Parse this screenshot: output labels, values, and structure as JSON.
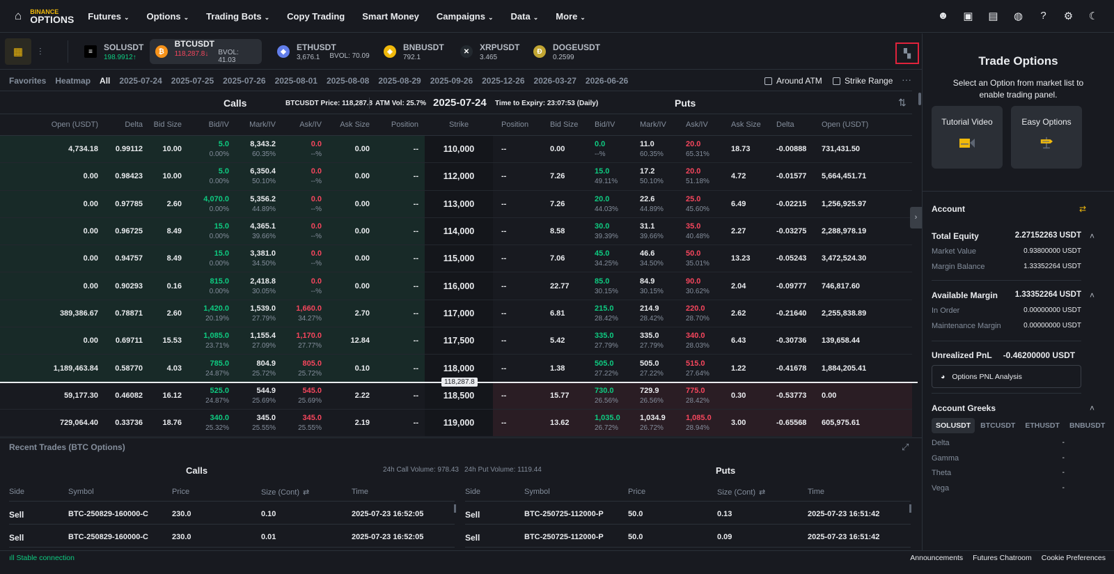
{
  "nav": {
    "logo_top": "BINANCE",
    "logo_bottom": "OPTIONS",
    "items": [
      {
        "label": "Futures",
        "dropdown": true
      },
      {
        "label": "Options",
        "dropdown": true
      },
      {
        "label": "Trading Bots",
        "dropdown": true
      },
      {
        "label": "Copy Trading",
        "dropdown": false
      },
      {
        "label": "Smart Money",
        "dropdown": false
      },
      {
        "label": "Campaigns",
        "dropdown": true
      },
      {
        "label": "Data",
        "dropdown": true
      },
      {
        "label": "More",
        "dropdown": true
      }
    ],
    "icons": [
      "user-icon",
      "wallet-icon",
      "orders-icon",
      "globe-icon",
      "help-icon",
      "gear-icon",
      "moon-icon"
    ]
  },
  "symbols": [
    {
      "name": "SOLUSDT",
      "price": "198.9912",
      "dir": "↑",
      "color": "#0ecb81",
      "bvol": "",
      "icon_bg": "#000000",
      "icon": "≡"
    },
    {
      "name": "BTCUSDT",
      "price": "118,287.8",
      "dir": "↓",
      "color": "#f6465d",
      "bvol": "BVOL: 41.03",
      "icon_bg": "#f7931a",
      "icon": "₿"
    },
    {
      "name": "ETHUSDT",
      "price": "3,676.1",
      "dir": "",
      "color": "#b7bdc6",
      "bvol": "BVOL: 70.09",
      "icon_bg": "#627eea",
      "icon": "◆"
    },
    {
      "name": "BNBUSDT",
      "price": "792.1",
      "dir": "",
      "color": "#b7bdc6",
      "bvol": "",
      "icon_bg": "#f0b90b",
      "icon": "◈"
    },
    {
      "name": "XRPUSDT",
      "price": "3.465",
      "dir": "",
      "color": "#b7bdc6",
      "bvol": "",
      "icon_bg": "#23292f",
      "icon": "✕"
    },
    {
      "name": "DOGEUSDT",
      "price": "0.2599",
      "dir": "",
      "color": "#b7bdc6",
      "bvol": "",
      "icon_bg": "#c2a633",
      "icon": "Ð"
    }
  ],
  "dates": {
    "tabs": [
      "Favorites",
      "Heatmap",
      "All",
      "2025-07-24",
      "2025-07-25",
      "2025-07-26",
      "2025-08-01",
      "2025-08-08",
      "2025-08-29",
      "2025-09-26",
      "2025-12-26",
      "2026-03-27",
      "2026-06-26"
    ],
    "active": "All",
    "around_atm": "Around ATM",
    "strike_range": "Strike Range"
  },
  "chain": {
    "calls_title": "Calls",
    "puts_title": "Puts",
    "price_label": "BTCUSDT Price: 118,287.8",
    "atm_vol": "ATM Vol: 25.7%",
    "expiry": "2025-07-24",
    "time_to_expiry": "Time to Expiry: 23:07:53 (Daily)",
    "index_price": "118,287.8",
    "call_columns": [
      "Open (USDT)",
      "Delta",
      "Bid Size",
      "Bid/IV",
      "Mark/IV",
      "Ask/IV",
      "Ask Size",
      "Position"
    ],
    "strike_column": "Strike",
    "put_columns": [
      "Position",
      "Bid Size",
      "Bid/IV",
      "Mark/IV",
      "Ask/IV",
      "Ask Size",
      "Delta",
      "Open (USDT)"
    ],
    "rows": [
      {
        "strike": "110,000",
        "call_itm": true,
        "put_itm": false,
        "call": {
          "open": "4,734.18",
          "delta": "0.99112",
          "bid_size": "10.00",
          "bid": "5.0",
          "bid_iv": "0.00%",
          "mark": "8,343.2",
          "mark_iv": "60.35%",
          "ask": "0.0",
          "ask_iv": "--%",
          "ask_size": "0.00",
          "position": "--"
        },
        "put": {
          "position": "--",
          "bid_size": "0.00",
          "bid": "0.0",
          "bid_iv": "--%",
          "mark": "11.0",
          "mark_iv": "60.35%",
          "ask": "20.0",
          "ask_iv": "65.31%",
          "ask_size": "18.73",
          "delta": "-0.00888",
          "open": "731,431.50"
        }
      },
      {
        "strike": "112,000",
        "call_itm": true,
        "put_itm": false,
        "call": {
          "open": "0.00",
          "delta": "0.98423",
          "bid_size": "10.00",
          "bid": "5.0",
          "bid_iv": "0.00%",
          "mark": "6,350.4",
          "mark_iv": "50.10%",
          "ask": "0.0",
          "ask_iv": "--%",
          "ask_size": "0.00",
          "position": "--"
        },
        "put": {
          "position": "--",
          "bid_size": "7.26",
          "bid": "15.0",
          "bid_iv": "49.11%",
          "mark": "17.2",
          "mark_iv": "50.10%",
          "ask": "20.0",
          "ask_iv": "51.18%",
          "ask_size": "4.72",
          "delta": "-0.01577",
          "open": "5,664,451.71"
        }
      },
      {
        "strike": "113,000",
        "call_itm": true,
        "put_itm": false,
        "call": {
          "open": "0.00",
          "delta": "0.97785",
          "bid_size": "2.60",
          "bid": "4,070.0",
          "bid_iv": "0.00%",
          "mark": "5,356.2",
          "mark_iv": "44.89%",
          "ask": "0.0",
          "ask_iv": "--%",
          "ask_size": "0.00",
          "position": "--"
        },
        "put": {
          "position": "--",
          "bid_size": "7.26",
          "bid": "20.0",
          "bid_iv": "44.03%",
          "mark": "22.6",
          "mark_iv": "44.89%",
          "ask": "25.0",
          "ask_iv": "45.60%",
          "ask_size": "6.49",
          "delta": "-0.02215",
          "open": "1,256,925.97"
        }
      },
      {
        "strike": "114,000",
        "call_itm": true,
        "put_itm": false,
        "call": {
          "open": "0.00",
          "delta": "0.96725",
          "bid_size": "8.49",
          "bid": "15.0",
          "bid_iv": "0.00%",
          "mark": "4,365.1",
          "mark_iv": "39.66%",
          "ask": "0.0",
          "ask_iv": "--%",
          "ask_size": "0.00",
          "position": "--"
        },
        "put": {
          "position": "--",
          "bid_size": "8.58",
          "bid": "30.0",
          "bid_iv": "39.39%",
          "mark": "31.1",
          "mark_iv": "39.66%",
          "ask": "35.0",
          "ask_iv": "40.48%",
          "ask_size": "2.27",
          "delta": "-0.03275",
          "open": "2,288,978.19"
        }
      },
      {
        "strike": "115,000",
        "call_itm": true,
        "put_itm": false,
        "call": {
          "open": "0.00",
          "delta": "0.94757",
          "bid_size": "8.49",
          "bid": "15.0",
          "bid_iv": "0.00%",
          "mark": "3,381.0",
          "mark_iv": "34.50%",
          "ask": "0.0",
          "ask_iv": "--%",
          "ask_size": "0.00",
          "position": "--"
        },
        "put": {
          "position": "--",
          "bid_size": "7.06",
          "bid": "45.0",
          "bid_iv": "34.25%",
          "mark": "46.6",
          "mark_iv": "34.50%",
          "ask": "50.0",
          "ask_iv": "35.01%",
          "ask_size": "13.23",
          "delta": "-0.05243",
          "open": "3,472,524.30"
        }
      },
      {
        "strike": "116,000",
        "call_itm": true,
        "put_itm": false,
        "call": {
          "open": "0.00",
          "delta": "0.90293",
          "bid_size": "0.16",
          "bid": "815.0",
          "bid_iv": "0.00%",
          "mark": "2,418.8",
          "mark_iv": "30.05%",
          "ask": "0.0",
          "ask_iv": "--%",
          "ask_size": "0.00",
          "position": "--"
        },
        "put": {
          "position": "--",
          "bid_size": "22.77",
          "bid": "85.0",
          "bid_iv": "30.15%",
          "mark": "84.9",
          "mark_iv": "30.15%",
          "ask": "90.0",
          "ask_iv": "30.62%",
          "ask_size": "2.04",
          "delta": "-0.09777",
          "open": "746,817.60"
        }
      },
      {
        "strike": "117,000",
        "call_itm": true,
        "put_itm": false,
        "call": {
          "open": "389,386.67",
          "delta": "0.78871",
          "bid_size": "2.60",
          "bid": "1,420.0",
          "bid_iv": "20.19%",
          "mark": "1,539.0",
          "mark_iv": "27.79%",
          "ask": "1,660.0",
          "ask_iv": "34.27%",
          "ask_size": "2.70",
          "position": "--"
        },
        "put": {
          "position": "--",
          "bid_size": "6.81",
          "bid": "215.0",
          "bid_iv": "28.42%",
          "mark": "214.9",
          "mark_iv": "28.42%",
          "ask": "220.0",
          "ask_iv": "28.70%",
          "ask_size": "2.62",
          "delta": "-0.21640",
          "open": "2,255,838.89"
        }
      },
      {
        "strike": "117,500",
        "call_itm": true,
        "put_itm": false,
        "call": {
          "open": "0.00",
          "delta": "0.69711",
          "bid_size": "15.53",
          "bid": "1,085.0",
          "bid_iv": "23.71%",
          "mark": "1,155.4",
          "mark_iv": "27.09%",
          "ask": "1,170.0",
          "ask_iv": "27.77%",
          "ask_size": "12.84",
          "position": "--"
        },
        "put": {
          "position": "--",
          "bid_size": "5.42",
          "bid": "335.0",
          "bid_iv": "27.79%",
          "mark": "335.0",
          "mark_iv": "27.79%",
          "ask": "340.0",
          "ask_iv": "28.03%",
          "ask_size": "6.43",
          "delta": "-0.30736",
          "open": "139,658.44"
        }
      },
      {
        "strike": "118,000",
        "call_itm": true,
        "put_itm": false,
        "call": {
          "open": "1,189,463.84",
          "delta": "0.58770",
          "bid_size": "4.03",
          "bid": "785.0",
          "bid_iv": "24.87%",
          "mark": "804.9",
          "mark_iv": "25.72%",
          "ask": "805.0",
          "ask_iv": "25.72%",
          "ask_size": "0.10",
          "position": "--"
        },
        "put": {
          "position": "--",
          "bid_size": "1.38",
          "bid": "505.0",
          "bid_iv": "27.22%",
          "mark": "505.0",
          "mark_iv": "27.22%",
          "ask": "515.0",
          "ask_iv": "27.64%",
          "ask_size": "1.22",
          "delta": "-0.41678",
          "open": "1,884,205.41"
        }
      },
      {
        "strike": "118,500",
        "call_itm": false,
        "put_itm": true,
        "call": {
          "open": "59,177.30",
          "delta": "0.46082",
          "bid_size": "16.12",
          "bid": "525.0",
          "bid_iv": "24.87%",
          "mark": "544.9",
          "mark_iv": "25.69%",
          "ask": "545.0",
          "ask_iv": "25.69%",
          "ask_size": "2.22",
          "position": "--"
        },
        "put": {
          "position": "--",
          "bid_size": "15.77",
          "bid": "730.0",
          "bid_iv": "26.56%",
          "mark": "729.9",
          "mark_iv": "26.56%",
          "ask": "775.0",
          "ask_iv": "28.42%",
          "ask_size": "0.30",
          "delta": "-0.53773",
          "open": "0.00"
        }
      },
      {
        "strike": "119,000",
        "call_itm": false,
        "put_itm": true,
        "call": {
          "open": "729,064.40",
          "delta": "0.33736",
          "bid_size": "18.76",
          "bid": "340.0",
          "bid_iv": "25.32%",
          "mark": "345.0",
          "mark_iv": "25.55%",
          "ask": "345.0",
          "ask_iv": "25.55%",
          "ask_size": "2.19",
          "position": "--"
        },
        "put": {
          "position": "--",
          "bid_size": "13.62",
          "bid": "1,035.0",
          "bid_iv": "26.72%",
          "mark": "1,034.9",
          "mark_iv": "26.72%",
          "ask": "1,085.0",
          "ask_iv": "28.94%",
          "ask_size": "3.00",
          "delta": "-0.65568",
          "open": "605,975.61"
        }
      }
    ]
  },
  "right_panel": {
    "title": "Trade Options",
    "subtitle": "Select an Option from market list to enable trading panel.",
    "tutorial": "Tutorial Video",
    "easy": "Easy Options",
    "account_title": "Account",
    "total_equity_label": "Total Equity",
    "total_equity": "2.27152263 USDT",
    "market_value_label": "Market Value",
    "market_value": "0.93800000 USDT",
    "margin_balance_label": "Margin Balance",
    "margin_balance": "1.33352264 USDT",
    "available_margin_label": "Available Margin",
    "available_margin": "1.33352264 USDT",
    "in_order_label": "In Order",
    "in_order": "0.00000000 USDT",
    "maint_label": "Maintenance Margin",
    "maint": "0.00000000 USDT",
    "upnl_label": "Unrealized PnL",
    "upnl": "-0.46200000 USDT",
    "pnl_button": "Options PNL Analysis",
    "greeks_title": "Account Greeks",
    "greek_tabs": [
      "SOLUSDT",
      "BTCUSDT",
      "ETHUSDT",
      "BNBUSDT"
    ],
    "greeks": [
      {
        "name": "Delta",
        "value": "-"
      },
      {
        "name": "Gamma",
        "value": "-"
      },
      {
        "name": "Theta",
        "value": "-"
      },
      {
        "name": "Vega",
        "value": "-"
      }
    ]
  },
  "trades": {
    "title": "Recent Trades (BTC Options)",
    "calls_title": "Calls",
    "puts_title": "Puts",
    "call_volume": "24h Call Volume: 978.43",
    "put_volume": "24h Put Volume: 1119.44",
    "columns": [
      "Side",
      "Symbol",
      "Price",
      "Size (Cont)",
      "Time"
    ],
    "calls": [
      {
        "side": "Sell",
        "symbol": "BTC-250829-160000-C",
        "price": "230.0",
        "size": "0.10",
        "time": "2025-07-23 16:52:05"
      },
      {
        "side": "Sell",
        "symbol": "BTC-250829-160000-C",
        "price": "230.0",
        "size": "0.01",
        "time": "2025-07-23 16:52:05"
      }
    ],
    "puts": [
      {
        "side": "Sell",
        "symbol": "BTC-250725-112000-P",
        "price": "50.0",
        "size": "0.13",
        "time": "2025-07-23 16:51:42"
      },
      {
        "side": "Sell",
        "symbol": "BTC-250725-112000-P",
        "price": "50.0",
        "size": "0.09",
        "time": "2025-07-23 16:51:42"
      }
    ]
  },
  "footer": {
    "connection": "Stable connection",
    "links": [
      "Announcements",
      "Futures Chatroom",
      "Cookie Preferences"
    ]
  },
  "colors": {
    "up": "#0ecb81",
    "down": "#f6465d",
    "accent": "#f0b90b",
    "bg": "#181a20"
  }
}
